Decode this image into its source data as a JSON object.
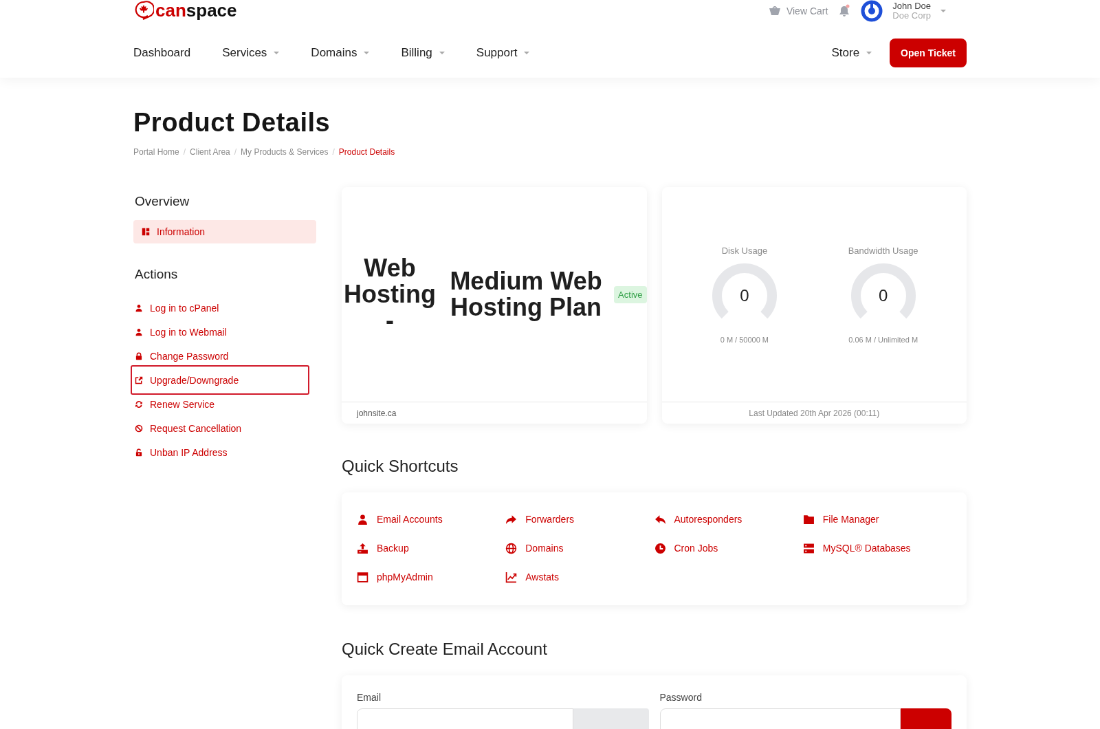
{
  "header": {
    "brand": {
      "part_1": "can",
      "part_2": "space"
    },
    "cart": "View Cart",
    "notifications": {
      "unread": true
    },
    "user": {
      "name": "John Doe",
      "company": "Doe Corp"
    },
    "nav": [
      {
        "label": "Dashboard",
        "dropdown": false
      },
      {
        "label": "Services",
        "dropdown": true
      },
      {
        "label": "Domains",
        "dropdown": true
      },
      {
        "label": "Billing",
        "dropdown": true
      },
      {
        "label": "Support",
        "dropdown": true
      }
    ],
    "nav_right": {
      "label": "Store",
      "dropdown": true
    },
    "cta": "Open Ticket"
  },
  "page": {
    "title": "Product Details",
    "separator": "/",
    "breadcrumb": [
      {
        "label": "Portal Home",
        "selected": false
      },
      {
        "label": "Client Area",
        "selected": false
      },
      {
        "label": "My Products & Services",
        "selected": false
      },
      {
        "label": "Product Details",
        "selected": true
      }
    ]
  },
  "sidebar": {
    "overview": {
      "title": "Overview",
      "items": [
        {
          "label": "Information",
          "selected": true
        }
      ]
    },
    "actions": {
      "title": "Actions",
      "items": [
        {
          "label": "Log in to cPanel",
          "focused": false
        },
        {
          "label": "Log in to Webmail",
          "focused": false
        },
        {
          "label": "Change Password",
          "focused": false
        },
        {
          "label": "Upgrade/Downgrade",
          "focused": true
        },
        {
          "label": "Renew Service",
          "focused": false
        },
        {
          "label": "Request Cancellation",
          "focused": false
        },
        {
          "label": "Unban IP Address",
          "focused": false
        }
      ]
    }
  },
  "product": {
    "group": "Web Hosting -",
    "name": "Medium Web Hosting Plan",
    "status": "Active",
    "domain": "johnsite.ca"
  },
  "usage": {
    "gauges": [
      {
        "title": "Disk Usage",
        "value": "0",
        "reading": "0 M / 50000 M"
      },
      {
        "title": "Bandwidth Usage",
        "value": "0",
        "reading": "0.06 M / Unlimited M"
      }
    ],
    "updated": "Last Updated 20th Apr 2026 (00:11)"
  },
  "shortcuts": {
    "title": "Quick Shortcuts",
    "items": [
      "Email Accounts",
      "Forwarders",
      "Autoresponders",
      "File Manager",
      "Backup",
      "Domains",
      "Cron Jobs",
      "MySQL® Databases",
      "phpMyAdmin",
      "Awstats"
    ]
  },
  "email_create": {
    "title": "Quick Create Email Account",
    "fields": [
      {
        "label": "Email"
      },
      {
        "label": "Password"
      }
    ]
  }
}
